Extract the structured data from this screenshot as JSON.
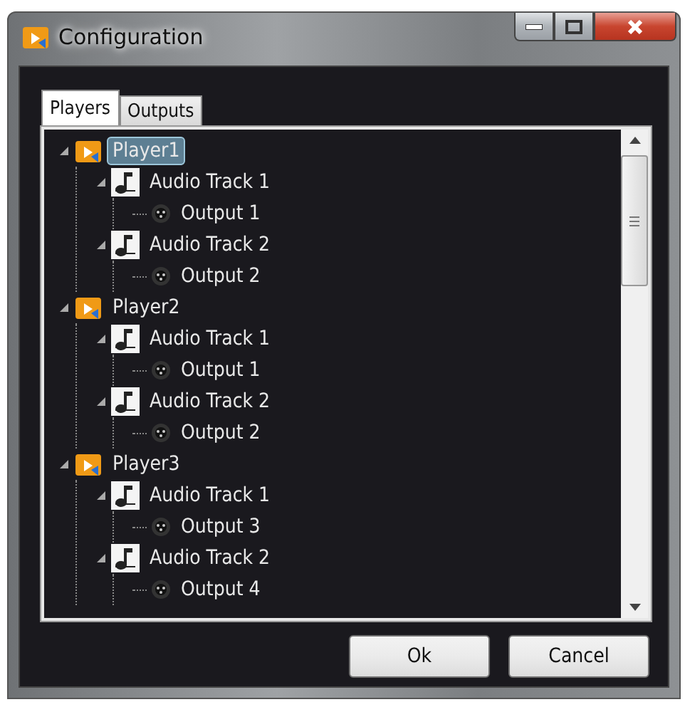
{
  "window": {
    "title": "Configuration"
  },
  "tabs": [
    {
      "label": "Players",
      "selected": true
    },
    {
      "label": "Outputs",
      "selected": false
    }
  ],
  "tree": [
    {
      "kind": "player",
      "label": "Player1",
      "selected": true,
      "expanded": true,
      "children": [
        {
          "kind": "track",
          "label": "Audio Track 1",
          "selected": false,
          "expanded": true,
          "children": [
            {
              "kind": "output",
              "label": "Output 1",
              "selected": false
            }
          ]
        },
        {
          "kind": "track",
          "label": "Audio Track 2",
          "selected": false,
          "expanded": true,
          "children": [
            {
              "kind": "output",
              "label": "Output 2",
              "selected": false
            }
          ]
        }
      ]
    },
    {
      "kind": "player",
      "label": "Player2",
      "selected": false,
      "expanded": true,
      "children": [
        {
          "kind": "track",
          "label": "Audio Track 1",
          "selected": false,
          "expanded": true,
          "children": [
            {
              "kind": "output",
              "label": "Output 1",
              "selected": false
            }
          ]
        },
        {
          "kind": "track",
          "label": "Audio Track 2",
          "selected": false,
          "expanded": true,
          "children": [
            {
              "kind": "output",
              "label": "Output 2",
              "selected": false
            }
          ]
        }
      ]
    },
    {
      "kind": "player",
      "label": "Player3",
      "selected": false,
      "expanded": true,
      "children": [
        {
          "kind": "track",
          "label": "Audio Track 1",
          "selected": false,
          "expanded": true,
          "children": [
            {
              "kind": "output",
              "label": "Output 3",
              "selected": false
            }
          ]
        },
        {
          "kind": "track",
          "label": "Audio Track 2",
          "selected": false,
          "expanded": true,
          "children": [
            {
              "kind": "output",
              "label": "Output 4",
              "selected": false
            }
          ]
        }
      ]
    }
  ],
  "buttons": [
    "Ok",
    "Cancel"
  ]
}
